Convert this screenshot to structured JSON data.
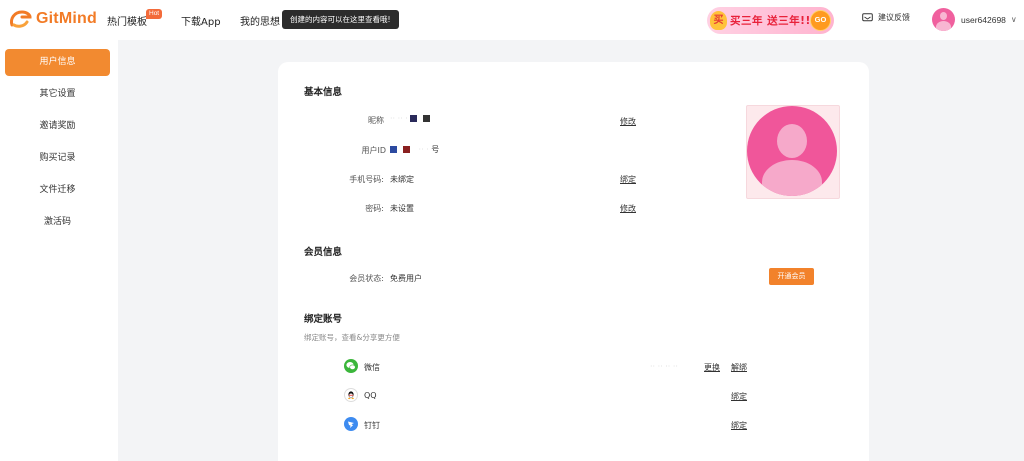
{
  "header": {
    "logo_text": "GitMind",
    "nav": [
      {
        "label": "热门模板"
      },
      {
        "label": "下载App"
      },
      {
        "label": "我的思想"
      }
    ],
    "hot_badge": "Hot",
    "tooltip": "创建的内容可以在这里查看哦!",
    "promo": {
      "gift_char": "买",
      "text": "买三年 送三年!!",
      "go_label": "GO"
    },
    "feedback_label": "建议反馈",
    "username": "user642698",
    "user_caret": "∨"
  },
  "sidebar": {
    "items": [
      {
        "label": "用户信息",
        "active": true
      },
      {
        "label": "其它设置"
      },
      {
        "label": "邀请奖励"
      },
      {
        "label": "购买记录"
      },
      {
        "label": "文件迁移"
      },
      {
        "label": "激活码"
      }
    ]
  },
  "basic_info": {
    "title": "基本信息",
    "nickname_label": "昵称",
    "nickname_edit": "修改",
    "userid_label": "用户ID",
    "userid_suffix": "号",
    "phone_label": "手机号码:",
    "phone_value": "未绑定",
    "phone_bind": "绑定",
    "password_label": "密码:",
    "password_value": "未设置",
    "password_edit": "修改"
  },
  "member_info": {
    "title": "会员信息",
    "status_label": "会员状态:",
    "status_value": "免费用户",
    "open_button": "开通会员"
  },
  "bind_accounts": {
    "title": "绑定账号",
    "subtitle": "绑定账号，查看&分享更方便",
    "accounts": [
      {
        "name": "微信",
        "action_change": "更换",
        "action_unbind": "解绑",
        "icon": "wechat-icon",
        "color": "#3bb63b"
      },
      {
        "name": "QQ",
        "action_bind": "绑定",
        "icon": "qq-icon",
        "color": "#ffffff"
      },
      {
        "name": "钉钉",
        "action_bind": "绑定",
        "icon": "dingtalk-icon",
        "color": "#3d8bf0"
      }
    ]
  },
  "colors": {
    "accent": "#f2822b",
    "brand": "#f27b26",
    "avatar_pink": "#f0569a"
  }
}
